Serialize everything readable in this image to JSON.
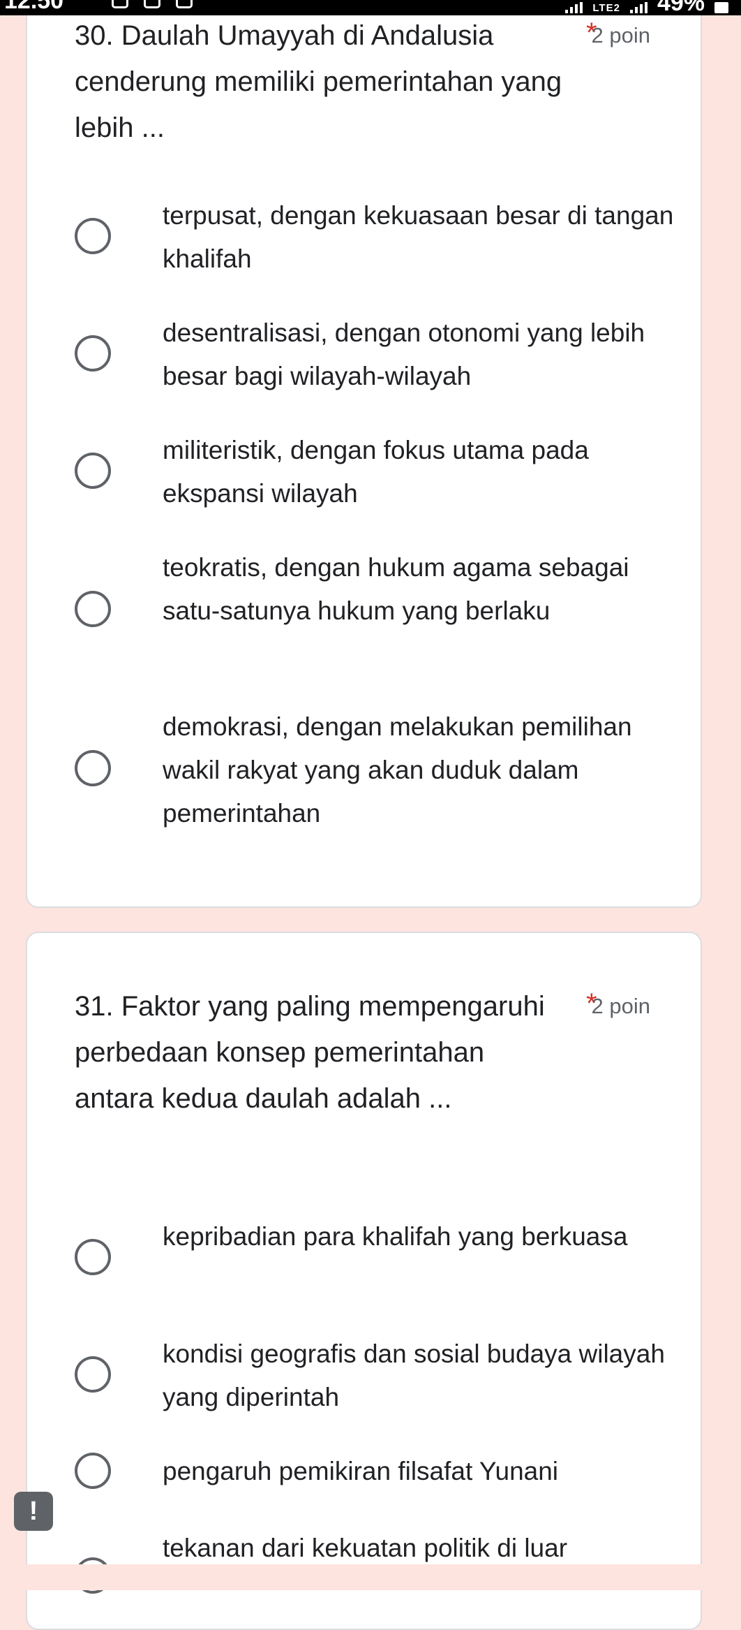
{
  "status_bar": {
    "time": "12.50",
    "network": "LTE2",
    "battery": "49%"
  },
  "questions": [
    {
      "text": "30. Daulah Umayyah di Andalusia cenderung memiliki pemerintahan yang lebih ...",
      "required_mark": "*",
      "points": "2 poin",
      "options": [
        "terpusat, dengan kekuasaan besar di tangan khalifah",
        "desentralisasi, dengan otonomi yang lebih besar bagi wilayah-wilayah",
        "militeristik, dengan fokus utama pada ekspansi wilayah",
        "teokratis, dengan hukum agama sebagai  satu-satunya hukum yang berlaku",
        "demokrasi, dengan melakukan pemilihan  wakil rakyat yang akan duduk dalam pemerintahan"
      ]
    },
    {
      "text": "31. Faktor yang paling mempengaruhi perbedaan konsep pemerintahan antara kedua daulah adalah ...",
      "required_mark": "*",
      "points": "2 poin",
      "options": [
        "kepribadian para khalifah yang berkuasa",
        "kondisi geografis dan sosial budaya wilayah yang diperintah",
        "pengaruh pemikiran filsafat Yunani",
        "tekanan dari kekuatan politik di luar"
      ]
    }
  ],
  "alert_badge": "!",
  "colors": {
    "background": "#fde4df",
    "card": "#ffffff",
    "required": "#d93025",
    "radio_border": "#5f6368"
  }
}
